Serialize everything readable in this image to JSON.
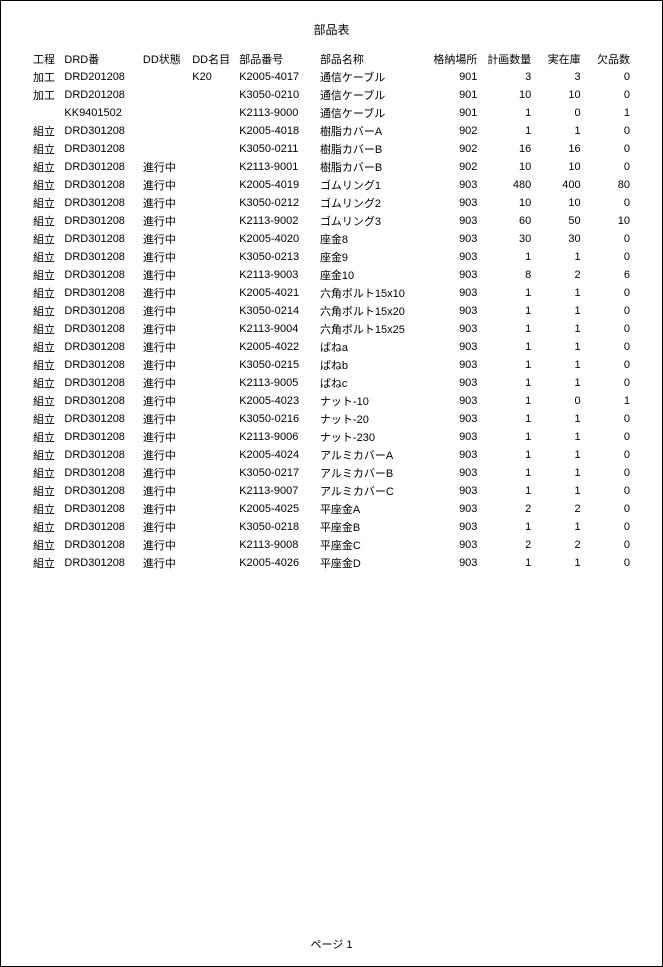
{
  "title": "部品表",
  "footer": "ページ 1",
  "columns": {
    "process": "工程",
    "drd": "DRD番",
    "ddstatus": "DD状態",
    "ddname": "DD名目",
    "partno": "部品番号",
    "partname": "部品名称",
    "loc": "格納場所",
    "plan": "計画数量",
    "stock": "実在庫",
    "short": "欠品数"
  },
  "rows": [
    {
      "process": "加工",
      "drd": "DRD201208",
      "ddstatus": "",
      "ddname": "K20",
      "partno": "K2005-4017",
      "partname": "通信ケーブル",
      "loc": 901,
      "plan": 3,
      "stock": 3,
      "short": 0
    },
    {
      "process": "加工",
      "drd": "DRD201208",
      "ddstatus": "",
      "ddname": "",
      "partno": "K3050-0210",
      "partname": "通信ケーブル",
      "loc": 901,
      "plan": 10,
      "stock": 10,
      "short": 0
    },
    {
      "process": "",
      "drd": "KK9401502",
      "ddstatus": "",
      "ddname": "",
      "partno": "K2113-9000",
      "partname": "通信ケーブル",
      "loc": 901,
      "plan": 1,
      "stock": 0,
      "short": 1
    },
    {
      "process": "組立",
      "drd": "DRD301208",
      "ddstatus": "",
      "ddname": "",
      "partno": "K2005-4018",
      "partname": "樹脂カバーA",
      "loc": 902,
      "plan": 1,
      "stock": 1,
      "short": 0
    },
    {
      "process": "組立",
      "drd": "DRD301208",
      "ddstatus": "",
      "ddname": "",
      "partno": "K3050-0211",
      "partname": "樹脂カバーB",
      "loc": 902,
      "plan": 16,
      "stock": 16,
      "short": 0
    },
    {
      "process": "組立",
      "drd": "DRD301208",
      "ddstatus": "進行中",
      "ddname": "",
      "partno": "K2113-9001",
      "partname": "樹脂カバーB",
      "loc": 902,
      "plan": 10,
      "stock": 10,
      "short": 0
    },
    {
      "process": "組立",
      "drd": "DRD301208",
      "ddstatus": "進行中",
      "ddname": "",
      "partno": "K2005-4019",
      "partname": "ゴムリング1",
      "loc": 903,
      "plan": 480,
      "stock": 400,
      "short": 80
    },
    {
      "process": "組立",
      "drd": "DRD301208",
      "ddstatus": "進行中",
      "ddname": "",
      "partno": "K3050-0212",
      "partname": "ゴムリング2",
      "loc": 903,
      "plan": 10,
      "stock": 10,
      "short": 0
    },
    {
      "process": "組立",
      "drd": "DRD301208",
      "ddstatus": "進行中",
      "ddname": "",
      "partno": "K2113-9002",
      "partname": "ゴムリング3",
      "loc": 903,
      "plan": 60,
      "stock": 50,
      "short": 10
    },
    {
      "process": "組立",
      "drd": "DRD301208",
      "ddstatus": "進行中",
      "ddname": "",
      "partno": "K2005-4020",
      "partname": "座金8",
      "loc": 903,
      "plan": 30,
      "stock": 30,
      "short": 0
    },
    {
      "process": "組立",
      "drd": "DRD301208",
      "ddstatus": "進行中",
      "ddname": "",
      "partno": "K3050-0213",
      "partname": "座金9",
      "loc": 903,
      "plan": 1,
      "stock": 1,
      "short": 0
    },
    {
      "process": "組立",
      "drd": "DRD301208",
      "ddstatus": "進行中",
      "ddname": "",
      "partno": "K2113-9003",
      "partname": "座金10",
      "loc": 903,
      "plan": 8,
      "stock": 2,
      "short": 6
    },
    {
      "process": "組立",
      "drd": "DRD301208",
      "ddstatus": "進行中",
      "ddname": "",
      "partno": "K2005-4021",
      "partname": "六角ボルト15x10",
      "loc": 903,
      "plan": 1,
      "stock": 1,
      "short": 0
    },
    {
      "process": "組立",
      "drd": "DRD301208",
      "ddstatus": "進行中",
      "ddname": "",
      "partno": "K3050-0214",
      "partname": "六角ボルト15x20",
      "loc": 903,
      "plan": 1,
      "stock": 1,
      "short": 0
    },
    {
      "process": "組立",
      "drd": "DRD301208",
      "ddstatus": "進行中",
      "ddname": "",
      "partno": "K2113-9004",
      "partname": "六角ボルト15x25",
      "loc": 903,
      "plan": 1,
      "stock": 1,
      "short": 0
    },
    {
      "process": "組立",
      "drd": "DRD301208",
      "ddstatus": "進行中",
      "ddname": "",
      "partno": "K2005-4022",
      "partname": "ばねa",
      "loc": 903,
      "plan": 1,
      "stock": 1,
      "short": 0
    },
    {
      "process": "組立",
      "drd": "DRD301208",
      "ddstatus": "進行中",
      "ddname": "",
      "partno": "K3050-0215",
      "partname": "ばねb",
      "loc": 903,
      "plan": 1,
      "stock": 1,
      "short": 0
    },
    {
      "process": "組立",
      "drd": "DRD301208",
      "ddstatus": "進行中",
      "ddname": "",
      "partno": "K2113-9005",
      "partname": "ばねc",
      "loc": 903,
      "plan": 1,
      "stock": 1,
      "short": 0
    },
    {
      "process": "組立",
      "drd": "DRD301208",
      "ddstatus": "進行中",
      "ddname": "",
      "partno": "K2005-4023",
      "partname": "ナット-10",
      "loc": 903,
      "plan": 1,
      "stock": 0,
      "short": 1
    },
    {
      "process": "組立",
      "drd": "DRD301208",
      "ddstatus": "進行中",
      "ddname": "",
      "partno": "K3050-0216",
      "partname": "ナット-20",
      "loc": 903,
      "plan": 1,
      "stock": 1,
      "short": 0
    },
    {
      "process": "組立",
      "drd": "DRD301208",
      "ddstatus": "進行中",
      "ddname": "",
      "partno": "K2113-9006",
      "partname": "ナット-230",
      "loc": 903,
      "plan": 1,
      "stock": 1,
      "short": 0
    },
    {
      "process": "組立",
      "drd": "DRD301208",
      "ddstatus": "進行中",
      "ddname": "",
      "partno": "K2005-4024",
      "partname": "アルミカバーA",
      "loc": 903,
      "plan": 1,
      "stock": 1,
      "short": 0
    },
    {
      "process": "組立",
      "drd": "DRD301208",
      "ddstatus": "進行中",
      "ddname": "",
      "partno": "K3050-0217",
      "partname": "アルミカバーB",
      "loc": 903,
      "plan": 1,
      "stock": 1,
      "short": 0
    },
    {
      "process": "組立",
      "drd": "DRD301208",
      "ddstatus": "進行中",
      "ddname": "",
      "partno": "K2113-9007",
      "partname": "アルミカバーC",
      "loc": 903,
      "plan": 1,
      "stock": 1,
      "short": 0
    },
    {
      "process": "組立",
      "drd": "DRD301208",
      "ddstatus": "進行中",
      "ddname": "",
      "partno": "K2005-4025",
      "partname": "平座金A",
      "loc": 903,
      "plan": 2,
      "stock": 2,
      "short": 0
    },
    {
      "process": "組立",
      "drd": "DRD301208",
      "ddstatus": "進行中",
      "ddname": "",
      "partno": "K3050-0218",
      "partname": "平座金B",
      "loc": 903,
      "plan": 1,
      "stock": 1,
      "short": 0
    },
    {
      "process": "組立",
      "drd": "DRD301208",
      "ddstatus": "進行中",
      "ddname": "",
      "partno": "K2113-9008",
      "partname": "平座金C",
      "loc": 903,
      "plan": 2,
      "stock": 2,
      "short": 0
    },
    {
      "process": "組立",
      "drd": "DRD301208",
      "ddstatus": "進行中",
      "ddname": "",
      "partno": "K2005-4026",
      "partname": "平座金D",
      "loc": 903,
      "plan": 1,
      "stock": 1,
      "short": 0
    }
  ]
}
